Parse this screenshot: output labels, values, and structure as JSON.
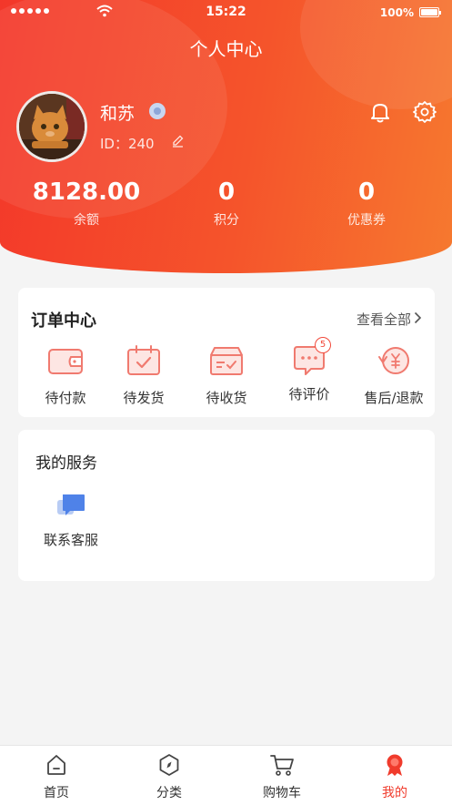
{
  "status_bar": {
    "time": "15:22",
    "battery": "100%"
  },
  "header": {
    "title": "个人中心",
    "user": {
      "name": "和苏",
      "id_text": "ID：240"
    },
    "stats": [
      {
        "value": "8128.00",
        "label": "余额"
      },
      {
        "value": "0",
        "label": "积分"
      },
      {
        "value": "0",
        "label": "优惠券"
      }
    ]
  },
  "orders": {
    "title": "订单中心",
    "view_all": "查看全部",
    "items": [
      {
        "label": "待付款",
        "icon": "wallet-icon"
      },
      {
        "label": "待发货",
        "icon": "calendar-check-icon"
      },
      {
        "label": "待收货",
        "icon": "package-icon"
      },
      {
        "label": "待评价",
        "icon": "comment-icon",
        "badge": "5"
      },
      {
        "label": "售后/退款",
        "icon": "refund-icon"
      }
    ]
  },
  "services": {
    "title": "我的服务",
    "items": [
      {
        "label": "联系客服",
        "icon": "chat-bubble-icon"
      }
    ]
  },
  "tabbar": {
    "items": [
      {
        "label": "首页",
        "icon": "home-icon"
      },
      {
        "label": "分类",
        "icon": "compass-icon"
      },
      {
        "label": "购物车",
        "icon": "cart-icon"
      },
      {
        "label": "我的",
        "icon": "ribbon-icon",
        "active": true
      }
    ]
  },
  "colors": {
    "accent": "#f03b2c",
    "header_start": "#f3372a",
    "header_end": "#f6792f",
    "icon_line": "#f07a6f"
  }
}
